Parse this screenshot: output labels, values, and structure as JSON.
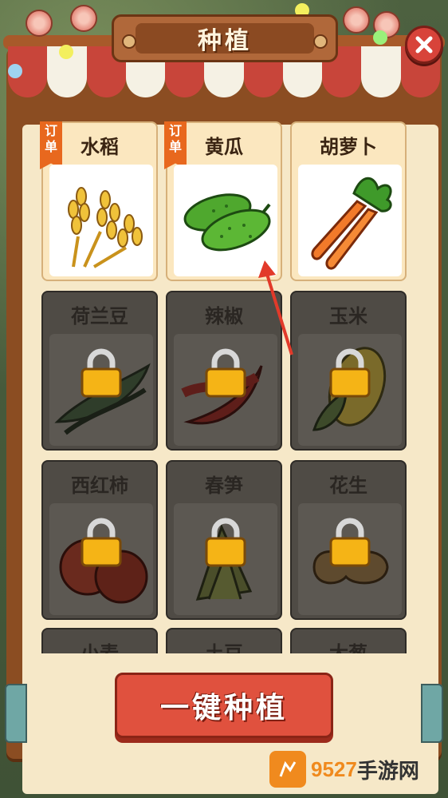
{
  "header": {
    "title": "种植"
  },
  "crops": [
    {
      "name": "水稻",
      "locked": false,
      "order": true,
      "icon": "rice-icon"
    },
    {
      "name": "黄瓜",
      "locked": false,
      "order": true,
      "icon": "cucumber-icon"
    },
    {
      "name": "胡萝卜",
      "locked": false,
      "order": false,
      "icon": "carrot-icon"
    },
    {
      "name": "荷兰豆",
      "locked": true,
      "order": false,
      "icon": "peapod-icon"
    },
    {
      "name": "辣椒",
      "locked": true,
      "order": false,
      "icon": "chili-icon"
    },
    {
      "name": "玉米",
      "locked": true,
      "order": false,
      "icon": "corn-icon"
    },
    {
      "name": "西红柿",
      "locked": true,
      "order": false,
      "icon": "tomato-icon"
    },
    {
      "name": "春笋",
      "locked": true,
      "order": false,
      "icon": "bamboo-shoot-icon"
    },
    {
      "name": "花生",
      "locked": true,
      "order": false,
      "icon": "peanut-icon"
    },
    {
      "name": "小麦",
      "locked": true,
      "order": false,
      "icon": "wheat-icon"
    },
    {
      "name": "土豆",
      "locked": true,
      "order": false,
      "icon": "potato-icon"
    },
    {
      "name": "大葱",
      "locked": true,
      "order": false,
      "icon": "scallion-icon"
    }
  ],
  "order_tag": {
    "line1": "订",
    "line2": "单"
  },
  "plant_button": {
    "label": "一键种植"
  },
  "watermark": {
    "number": "9527",
    "text": "手游网"
  },
  "colors": {
    "panel": "#8b4d22",
    "card_unlocked": "#fbe7bf",
    "card_locked": "#4f4b45",
    "button": "#e0513e",
    "order_tag": "#e8681e"
  }
}
